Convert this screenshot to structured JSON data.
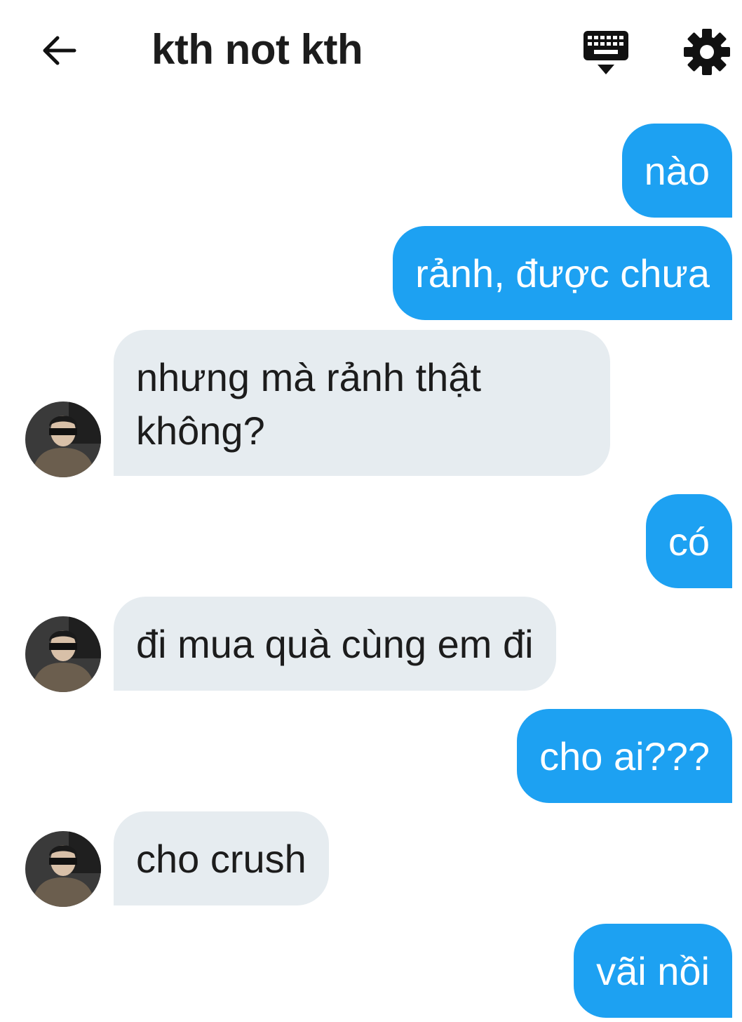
{
  "header": {
    "title": "kth not kth",
    "back_icon": "arrow-left-icon",
    "keyboard_icon": "keyboard-hide-icon",
    "settings_icon": "gear-icon"
  },
  "colors": {
    "outgoing_bubble": "#1da1f2",
    "incoming_bubble": "#e6ecf0",
    "text_dark": "#1c1c1c"
  },
  "messages": [
    {
      "direction": "out",
      "text": "nào"
    },
    {
      "direction": "out",
      "text": "rảnh, được chưa"
    },
    {
      "direction": "in",
      "text": "nhưng mà rảnh thật không?"
    },
    {
      "direction": "out",
      "text": "có"
    },
    {
      "direction": "in",
      "text": "đi mua quà cùng em đi"
    },
    {
      "direction": "out",
      "text": "cho ai???"
    },
    {
      "direction": "in",
      "text": "cho crush"
    },
    {
      "direction": "out",
      "text": "vãi nồi"
    }
  ]
}
